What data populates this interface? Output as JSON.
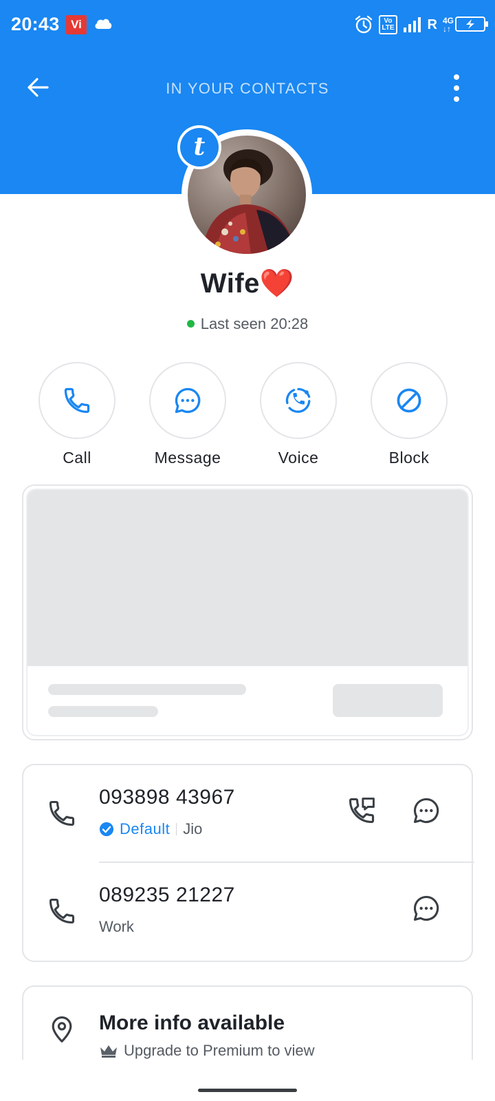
{
  "status_bar": {
    "time": "20:43",
    "carrier_badge": "Vi",
    "volte_label": "Vo\nLTE",
    "roaming_label": "R",
    "network_label": "4G"
  },
  "header": {
    "title": "IN YOUR CONTACTS"
  },
  "contact": {
    "badge_letter": "t",
    "name": "Wife❤️",
    "last_seen": "Last seen 20:28"
  },
  "actions": [
    {
      "label": "Call",
      "icon": "phone-icon"
    },
    {
      "label": "Message",
      "icon": "chat-icon"
    },
    {
      "label": "Voice",
      "icon": "voice-call-icon"
    },
    {
      "label": "Block",
      "icon": "block-icon"
    }
  ],
  "phones": [
    {
      "number": "093898 43967",
      "default_label": "Default",
      "carrier": "Jio"
    },
    {
      "number": "089235 21227",
      "type": "Work"
    }
  ],
  "more_info": {
    "title": "More info available",
    "subtitle": "Upgrade to Premium to view"
  },
  "colors": {
    "brand_blue": "#1a87f2",
    "online_green": "#1fb845",
    "skeleton": "#e4e5e7"
  }
}
